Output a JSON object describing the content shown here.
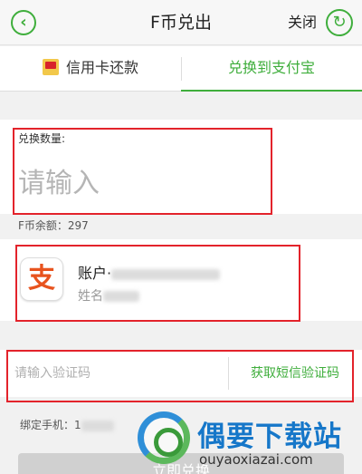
{
  "header": {
    "title": "F币兑出",
    "close_label": "关闭",
    "back_icon": "back-arrow-icon",
    "refresh_icon": "refresh-icon"
  },
  "tabs": [
    {
      "label": "信用卡还款",
      "active": false,
      "icon": "credit-card-icon"
    },
    {
      "label": "兑换到支付宝",
      "active": true
    }
  ],
  "exchange": {
    "quantity_label": "兑换数量:",
    "quantity_placeholder": "请输入",
    "balance_text": "F币余额：297"
  },
  "account": {
    "logo_char": "支",
    "account_prefix": "账户·",
    "name_prefix": "姓名"
  },
  "verify": {
    "code_placeholder": "请输入验证码",
    "sms_button_label": "获取短信验证码",
    "phone_prefix": "绑定手机：1"
  },
  "confirm": {
    "label": "立即兑换"
  },
  "watermark": {
    "text": "偶要下载站",
    "url": "ouyaoxiazai.com"
  },
  "colors": {
    "accent_green": "#3fae3c",
    "highlight_red": "#e3232b",
    "alipay_blue": "#1a6fb5",
    "watermark_blue": "#1677c9"
  }
}
